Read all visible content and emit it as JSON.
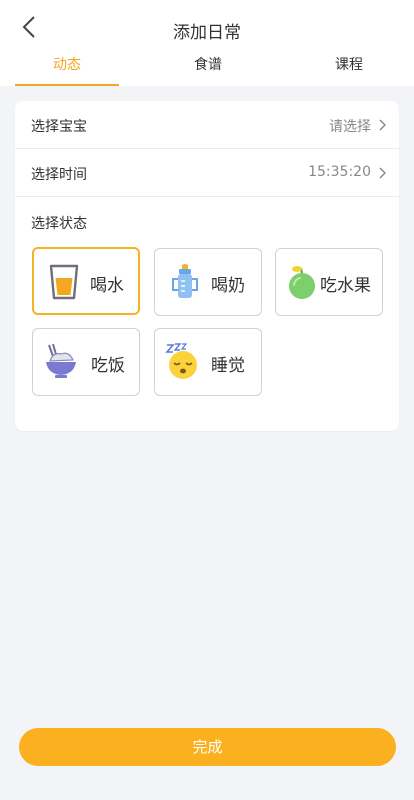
{
  "header": {
    "title": "添加日常",
    "back_icon": "chevron-left-icon"
  },
  "tabs": [
    {
      "label": "动态",
      "active": true
    },
    {
      "label": "食谱",
      "active": false
    },
    {
      "label": "课程",
      "active": false
    }
  ],
  "form": {
    "baby": {
      "label": "选择宝宝",
      "value": "请选择"
    },
    "time": {
      "label": "选择时间",
      "value": "15:35:20"
    },
    "status_label": "选择状态",
    "statuses": [
      {
        "label": "喝水",
        "icon": "water-cup-icon",
        "selected": true
      },
      {
        "label": "喝奶",
        "icon": "baby-bottle-icon",
        "selected": false
      },
      {
        "label": "吃水果",
        "icon": "apple-icon",
        "selected": false
      },
      {
        "label": "吃饭",
        "icon": "rice-bowl-icon",
        "selected": false
      },
      {
        "label": "睡觉",
        "icon": "sleeping-face-icon",
        "selected": false
      }
    ]
  },
  "footer": {
    "done_label": "完成"
  },
  "colors": {
    "accent": "#f5a623",
    "button": "#fbb01f",
    "background": "#f3f4f8"
  }
}
